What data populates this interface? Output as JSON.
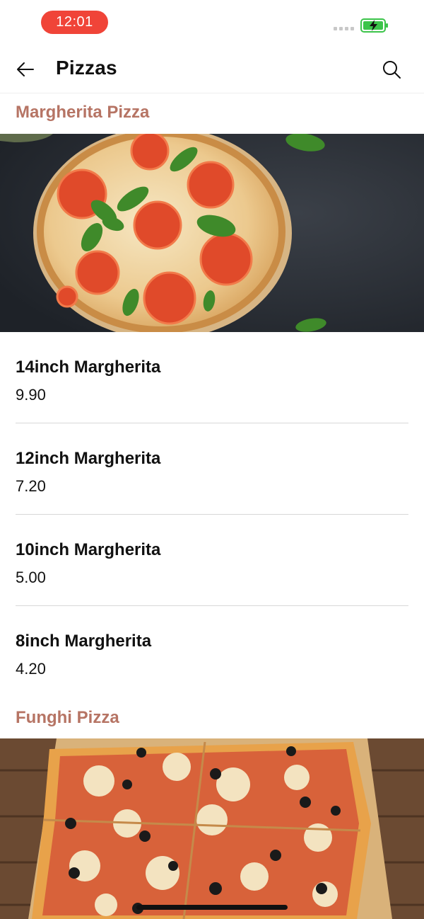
{
  "status_bar": {
    "time": "12:01"
  },
  "header": {
    "title": "Pizzas"
  },
  "sections": [
    {
      "title": "Margherita Pizza",
      "items": [
        {
          "name": "14inch Margherita",
          "price": "9.90"
        },
        {
          "name": "12inch Margherita",
          "price": "7.20"
        },
        {
          "name": "10inch Margherita",
          "price": "5.00"
        },
        {
          "name": "8inch Margherita",
          "price": "4.20"
        }
      ]
    },
    {
      "title": "Funghi Pizza"
    }
  ],
  "icons": {
    "back": "arrow-left-icon",
    "search": "search-icon",
    "battery": "battery-charging-icon"
  },
  "colors": {
    "accent": "#b67464",
    "time_pill": "#f04438",
    "battery": "#3cc44a"
  }
}
